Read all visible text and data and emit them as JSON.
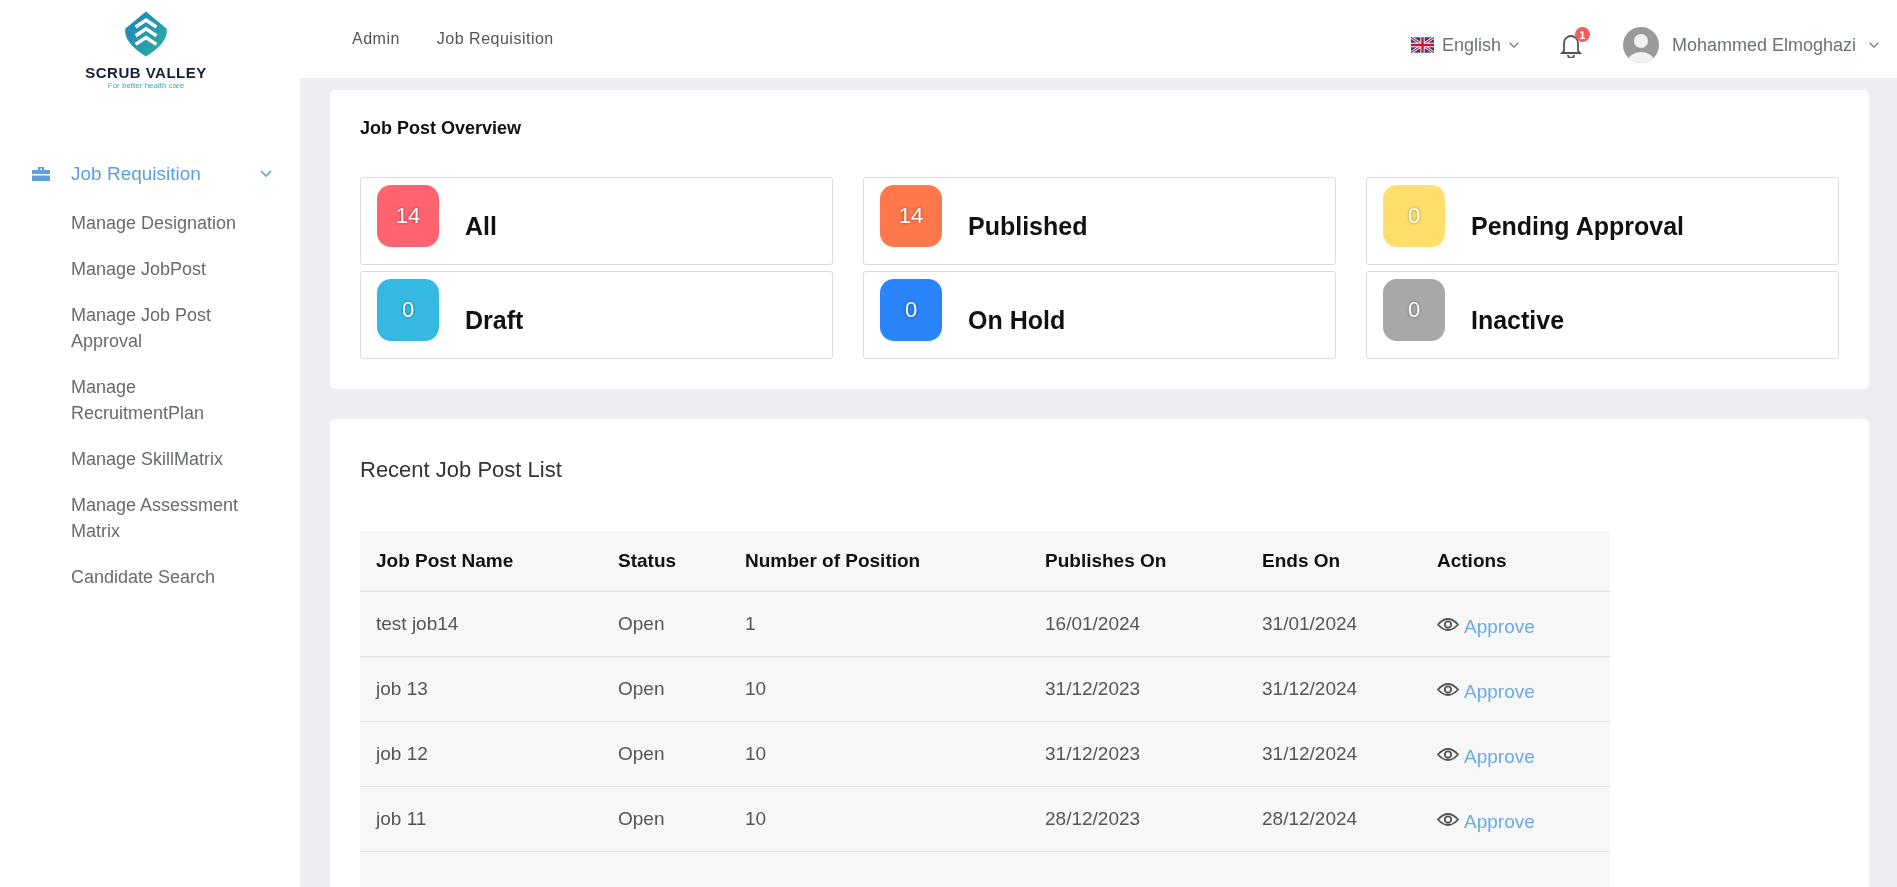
{
  "brand": {
    "name": "SCRUB VALLEY",
    "tagline": "For better health care"
  },
  "sidebar": {
    "section": {
      "label": "Job Requisition",
      "expanded": true
    },
    "items": [
      {
        "label": "Manage Designation"
      },
      {
        "label": "Manage JobPost"
      },
      {
        "label": "Manage Job Post Approval"
      },
      {
        "label": "Manage RecruitmentPlan"
      },
      {
        "label": "Manage SkillMatrix"
      },
      {
        "label": "Manage Assessment Matrix"
      },
      {
        "label": "Candidate Search"
      }
    ]
  },
  "breadcrumbs": [
    "Admin",
    "Job Requisition"
  ],
  "header": {
    "language": "English",
    "notifications": "1",
    "user": "Mohammed Elmoghazi"
  },
  "overview": {
    "title": "Job Post Overview",
    "stats": [
      {
        "count": "14",
        "label": "All",
        "color": "#ff6370"
      },
      {
        "count": "14",
        "label": "Published",
        "color": "#ff774a"
      },
      {
        "count": "0",
        "label": "Pending Approval",
        "color": "#ffde6b"
      },
      {
        "count": "0",
        "label": "Draft",
        "color": "#36b9e0"
      },
      {
        "count": "0",
        "label": "On Hold",
        "color": "#2a84fa"
      },
      {
        "count": "0",
        "label": "Inactive",
        "color": "#a8a8a8"
      }
    ]
  },
  "recent": {
    "title": "Recent Job Post List",
    "columns": [
      "Job Post Name",
      "Status",
      "Number of Position",
      "Publishes On",
      "Ends On",
      "Actions"
    ],
    "rows": [
      {
        "name": "test job14",
        "status": "Open",
        "positions": "1",
        "publishes": "16/01/2024",
        "ends": "31/01/2024",
        "action": "Approve"
      },
      {
        "name": "job 13",
        "status": "Open",
        "positions": "10",
        "publishes": "31/12/2023",
        "ends": "31/12/2024",
        "action": "Approve"
      },
      {
        "name": "job 12",
        "status": "Open",
        "positions": "10",
        "publishes": "31/12/2023",
        "ends": "31/12/2024",
        "action": "Approve"
      },
      {
        "name": "job 11",
        "status": "Open",
        "positions": "10",
        "publishes": "28/12/2023",
        "ends": "28/12/2024",
        "action": "Approve"
      }
    ]
  }
}
